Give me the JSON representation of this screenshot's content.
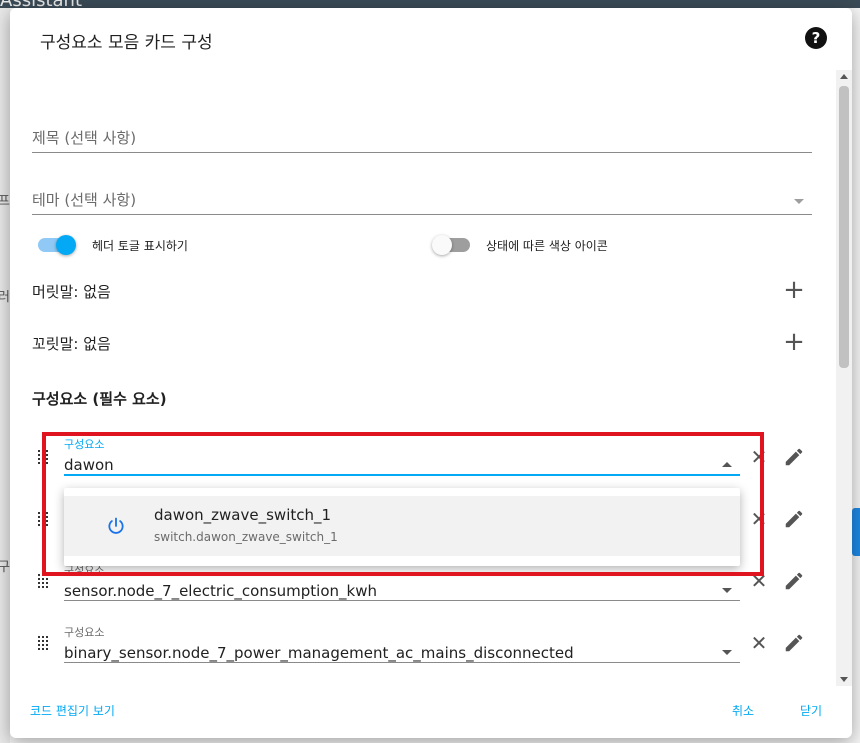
{
  "background": {
    "top_fragment": "Assistant",
    "left_fragments": [
      "프",
      "러",
      "구"
    ]
  },
  "dialog": {
    "title": "구성요소 모음 카드 구성",
    "help_icon": "?",
    "title_field": {
      "placeholder": "제목 (선택 사항)"
    },
    "theme_field": {
      "placeholder": "테마 (선택 사항)"
    },
    "toggles": [
      {
        "label": "헤더 토글 표시하기",
        "on": true
      },
      {
        "label": "상태에 따른 색상 아이콘",
        "on": false
      }
    ],
    "header_row": {
      "label": "머릿말: 없음",
      "add": "+"
    },
    "footer_row": {
      "label": "꼬릿말: 없음",
      "add": "+"
    },
    "entities_title": "구성요소 (필수 요소)",
    "entities": [
      {
        "label": "구성요소",
        "value": "dawon",
        "active": true
      },
      {
        "label": "구성요소",
        "value": "sensor.node_7_electric_consumption_kwh"
      },
      {
        "label": "구성요소",
        "value": "binary_sensor.node_7_power_management_ac_mains_disconnected"
      }
    ],
    "remove_icon": "✕",
    "dropdown": {
      "items": [
        {
          "name": "dawon_zwave_switch_1",
          "entity_id": "switch.dawon_zwave_switch_1",
          "icon": "power-icon"
        }
      ]
    },
    "footer": {
      "code_editor": "코드 편집기 보기",
      "cancel": "취소",
      "close": "닫기"
    }
  },
  "colors": {
    "accent": "#03a9f4",
    "highlight": "#e0141e",
    "icon_blue": "#1a73e8"
  }
}
